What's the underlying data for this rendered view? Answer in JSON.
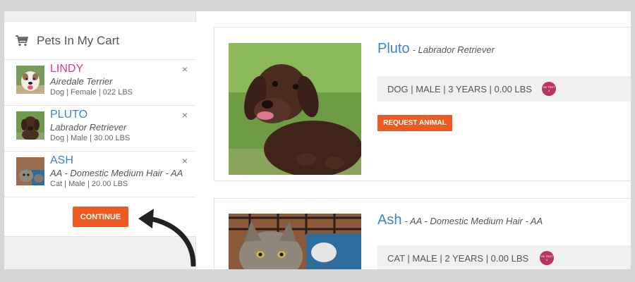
{
  "cart": {
    "title": "Pets In My Cart",
    "icon": "shopping-cart-icon",
    "items": [
      {
        "name": "LINDY",
        "name_color": "#d0399a",
        "breed": "Airedale Terrier",
        "meta": "Dog | Female | 022 LBS",
        "remove": "×"
      },
      {
        "name": "PLUTO",
        "name_color": "#3b86c6",
        "breed": "Labrador Retriever",
        "meta": "Dog | Male | 30.00 LBS",
        "remove": "×"
      },
      {
        "name": "ASH",
        "name_color": "#3b86c6",
        "breed": "AA - Domestic Medium Hair - AA",
        "meta": "Cat | Male | 20.00 LBS",
        "remove": "×"
      }
    ],
    "continue_label": "CONTINUE"
  },
  "listings": [
    {
      "name": "Pluto",
      "breed": "- Labrador Retriever",
      "stats": "DOG | MALE | 3 YEARS | 0.00 LBS",
      "badge": "HK TEST 4",
      "request_label": "REQUEST ANIMAL"
    },
    {
      "name": "Ash",
      "breed": "- AA - Domestic Medium Hair - AA",
      "stats": "CAT | MALE | 2 YEARS | 0.00 LBS",
      "badge": "HK TEST 4"
    }
  ],
  "colors": {
    "accent": "#ee5a24",
    "link": "#3b86c6",
    "badge": "#b73560"
  }
}
